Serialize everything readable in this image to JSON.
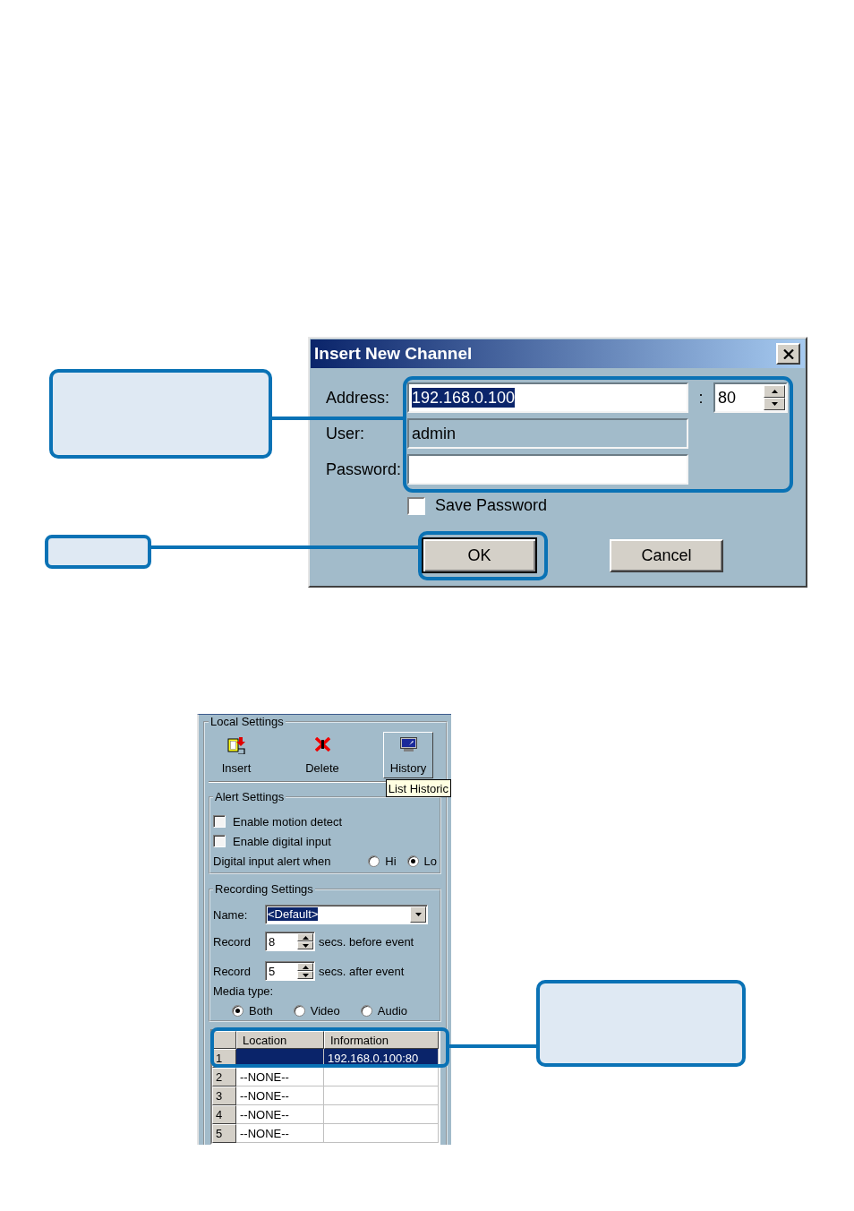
{
  "dialog": {
    "title": "Insert New Channel",
    "fields": [
      {
        "label": "Address:",
        "value": "192.168.0.100",
        "highlighted": true,
        "disabled": false
      },
      {
        "label": "User:",
        "value": "admin",
        "highlighted": false,
        "disabled": true
      },
      {
        "label": "Password:",
        "disabled": false
      }
    ],
    "port": {
      "separator": ":",
      "value": "80"
    },
    "save_password": {
      "label": "Save Password",
      "checked": false
    },
    "buttons": [
      {
        "label": "OK",
        "default": true
      },
      {
        "label": "Cancel",
        "default": false
      }
    ]
  },
  "local_settings": {
    "title": "Local Settings",
    "toolbar": [
      {
        "kind": "insert",
        "label": "Insert",
        "raised": false
      },
      {
        "kind": "delete",
        "label": "Delete",
        "raised": false
      },
      {
        "kind": "history",
        "label": "History",
        "raised": true
      }
    ],
    "tooltip": "List Historic",
    "alert_settings": {
      "title": "Alert Settings",
      "checkboxes": [
        {
          "label": "Enable motion detect",
          "checked": false
        },
        {
          "label": "Enable digital input",
          "checked": false
        }
      ],
      "alert_when": {
        "label": "Digital input alert when",
        "options": [
          {
            "label": "Hi",
            "selected": false
          },
          {
            "label": "Lo",
            "selected": true
          }
        ]
      }
    },
    "recording_settings": {
      "title": "Recording Settings",
      "name": {
        "label": "Name:",
        "value": "<Default>",
        "highlighted": true
      },
      "record": [
        {
          "label": "Record",
          "value": "8",
          "unit": "secs. before event"
        },
        {
          "label": "Record",
          "value": "5",
          "unit": "secs. after event"
        }
      ],
      "media_type": {
        "label": "Media type:",
        "options": [
          {
            "label": "Both",
            "selected": true
          },
          {
            "label": "Video",
            "selected": false
          },
          {
            "label": "Audio",
            "selected": false
          }
        ]
      }
    },
    "table": {
      "columns": [
        "Location",
        "Information"
      ],
      "rows": [
        {
          "number": "1",
          "information": "192.168.0.100:80",
          "selected": true
        },
        {
          "number": "2",
          "location": "--NONE--",
          "selected": false
        },
        {
          "number": "3",
          "location": "--NONE--",
          "selected": false
        },
        {
          "number": "4",
          "location": "--NONE--",
          "selected": false
        },
        {
          "number": "5",
          "location": "--NONE--",
          "selected": false
        }
      ]
    }
  }
}
